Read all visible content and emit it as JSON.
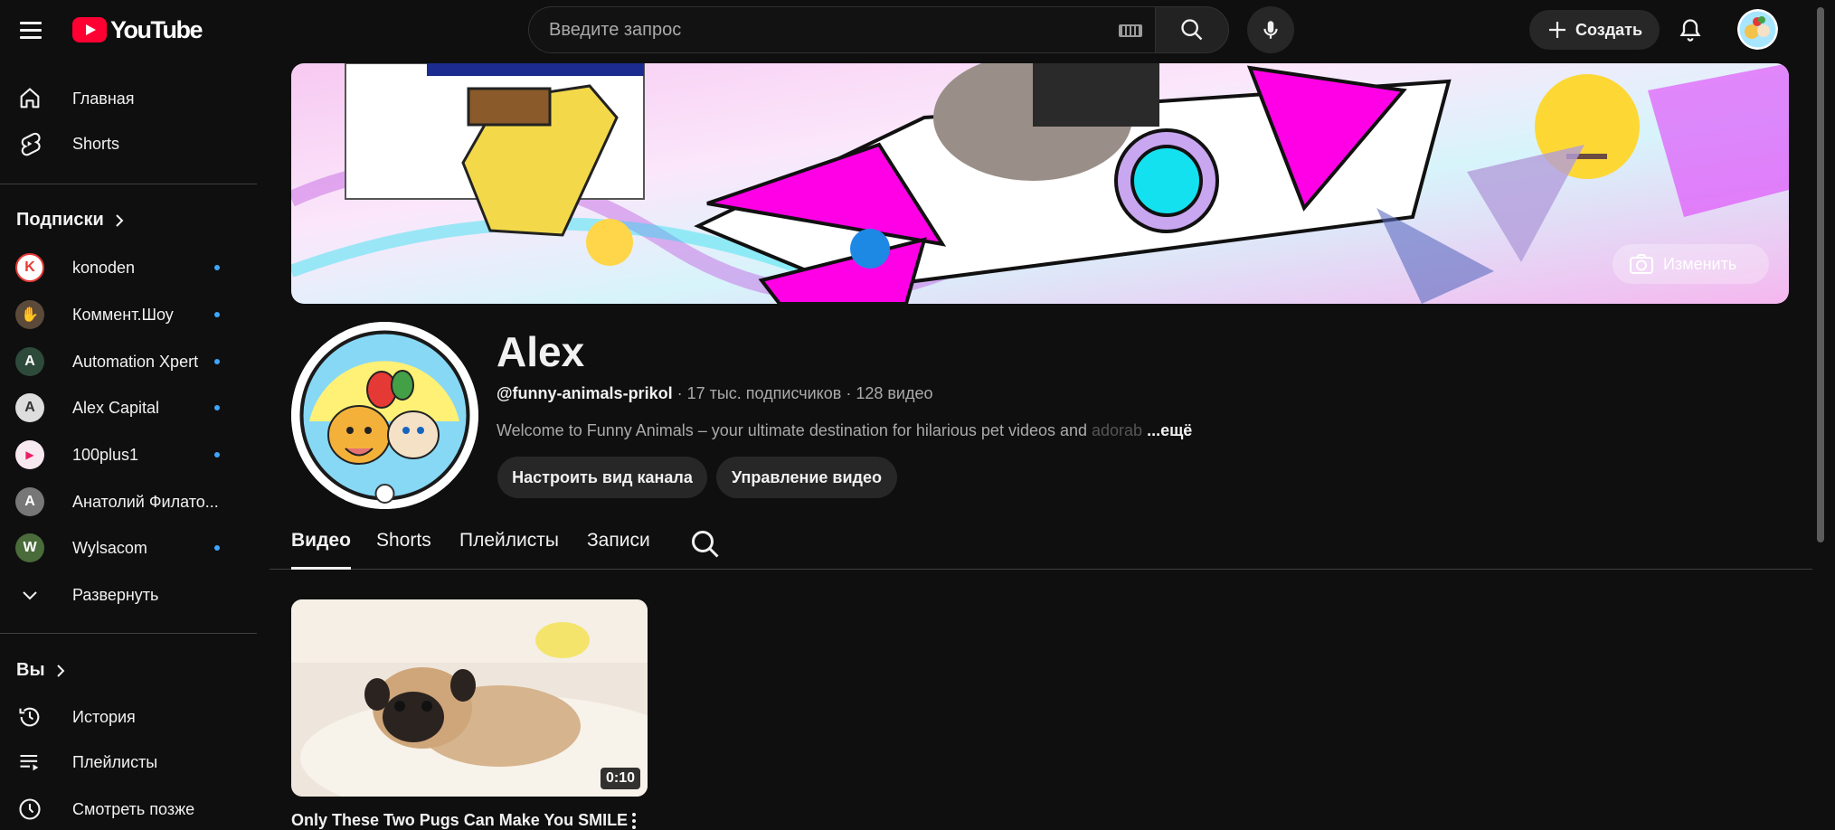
{
  "header": {
    "logo_text": "YouTube",
    "search_placeholder": "Введите запрос",
    "create_label": "Создать"
  },
  "sidebar": {
    "main": [
      {
        "label": "Главная",
        "icon": "home-icon"
      },
      {
        "label": "Shorts",
        "icon": "shorts-icon"
      }
    ],
    "subscriptions_title": "Подписки",
    "subscriptions": [
      {
        "label": "konoden",
        "avatar_letter": "K",
        "avatar_bg": "#ffffff",
        "avatar_fg": "#e53935"
      },
      {
        "label": "Коммент.Шоу",
        "avatar_letter": "✋",
        "avatar_bg": "#5b4a3a",
        "avatar_fg": "#ffffff"
      },
      {
        "label": "Automation Xpert",
        "avatar_letter": "A",
        "avatar_bg": "#2d4a3a",
        "avatar_fg": "#ffffff"
      },
      {
        "label": "Alex Capital",
        "avatar_letter": "A",
        "avatar_bg": "#dddddd",
        "avatar_fg": "#333333"
      },
      {
        "label": "100plus1",
        "avatar_letter": "▶",
        "avatar_bg": "#f8e8f0",
        "avatar_fg": "#e91e63"
      },
      {
        "label": "Анатолий Филато...",
        "avatar_letter": "А",
        "avatar_bg": "#777777",
        "avatar_fg": "#ffffff"
      },
      {
        "label": "Wylsacom",
        "avatar_letter": "W",
        "avatar_bg": "#4a6b3a",
        "avatar_fg": "#ffffff"
      }
    ],
    "expand_label": "Развернуть",
    "you_title": "Вы",
    "you_items": [
      {
        "label": "История",
        "icon": "history-icon"
      },
      {
        "label": "Плейлисты",
        "icon": "playlists-icon"
      },
      {
        "label": "Смотреть позже",
        "icon": "watch-later-icon"
      }
    ]
  },
  "banner": {
    "edit_label": "Изменить"
  },
  "channel": {
    "name": "Alex",
    "handle": "@funny-animals-prikol",
    "meta": " · 17 тыс. подписчиков · 128 видео",
    "description": "Welcome to Funny Animals – your ultimate destination for hilarious pet videos and ",
    "description_fade": "adorab",
    "description_more": "...ещё",
    "avatar_title": "Funny Animals",
    "buttons": {
      "customize": "Настроить вид канала",
      "manage": "Управление видео"
    }
  },
  "tabs": [
    {
      "label": "Видео",
      "active": true
    },
    {
      "label": "Shorts",
      "active": false
    },
    {
      "label": "Плейлисты",
      "active": false
    },
    {
      "label": "Записи",
      "active": false
    }
  ],
  "videos": [
    {
      "title": "Only These Two Pugs Can Make You SMILE",
      "duration": "0:10"
    }
  ],
  "colors": {
    "background": "#0f0f0f",
    "brand_red": "#ff0033",
    "accent_blue": "#3ea6ff",
    "banner_magenta": "#ff00e6",
    "banner_cyan": "#14e1f0"
  }
}
